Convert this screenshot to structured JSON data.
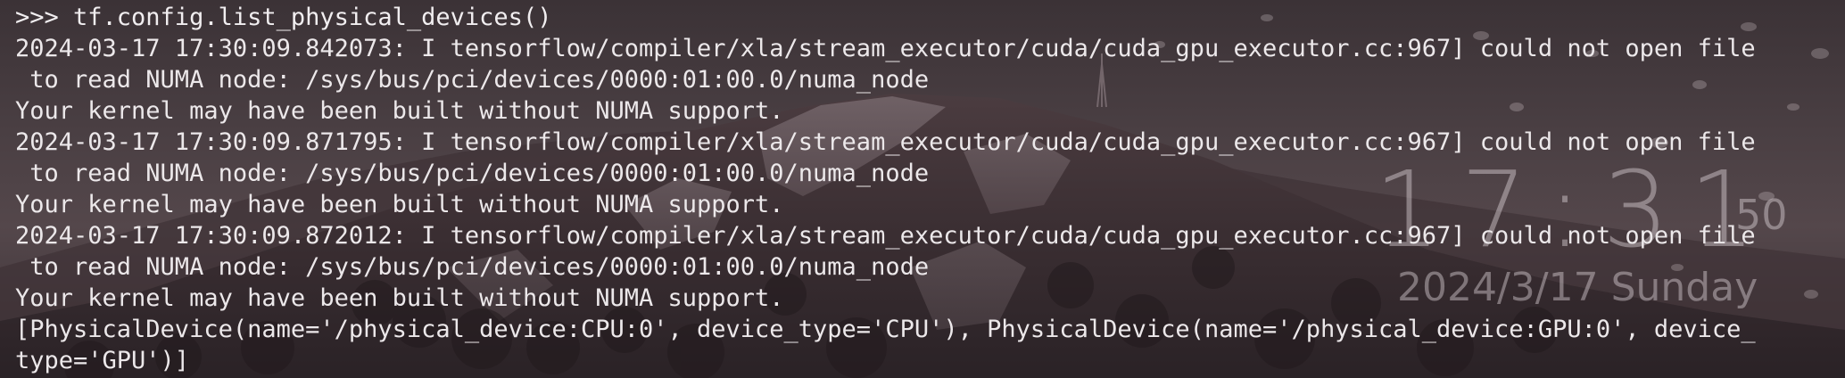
{
  "terminal": {
    "lines": [
      ">>> tf.config.list_physical_devices()",
      "2024-03-17 17:30:09.842073: I tensorflow/compiler/xla/stream_executor/cuda/cuda_gpu_executor.cc:967] could not open file",
      " to read NUMA node: /sys/bus/pci/devices/0000:01:00.0/numa_node",
      "Your kernel may have been built without NUMA support.",
      "2024-03-17 17:30:09.871795: I tensorflow/compiler/xla/stream_executor/cuda/cuda_gpu_executor.cc:967] could not open file",
      " to read NUMA node: /sys/bus/pci/devices/0000:01:00.0/numa_node",
      "Your kernel may have been built without NUMA support.",
      "2024-03-17 17:30:09.872012: I tensorflow/compiler/xla/stream_executor/cuda/cuda_gpu_executor.cc:967] could not open file",
      " to read NUMA node: /sys/bus/pci/devices/0000:01:00.0/numa_node",
      "Your kernel may have been built without NUMA support.",
      "[PhysicalDevice(name='/physical_device:CPU:0', device_type='CPU'), PhysicalDevice(name='/physical_device:GPU:0', device_",
      "type='GPU')]"
    ]
  },
  "clock": {
    "time": "17:31",
    "seconds": "50",
    "date": "2024/3/17 Sunday"
  },
  "colors": {
    "terminal_text": "#ece8ea",
    "clock_text": "#e6dee2"
  }
}
